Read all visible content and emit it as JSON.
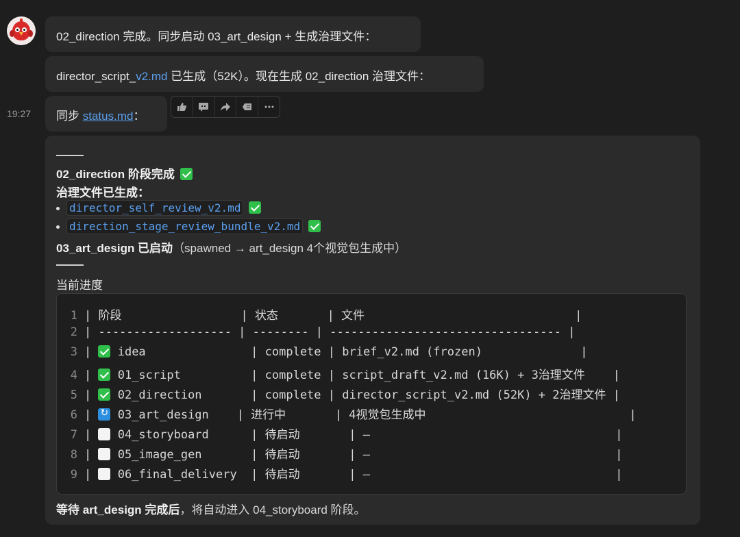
{
  "messages": {
    "m1": "02_direction 完成。同步启动 03_art_design + 生成治理文件：",
    "m2_a": "director_script_",
    "m2_link": "v2.md",
    "m2_b": " 已生成（52K）。现在生成 02_direction 治理文件：",
    "m3_a": "同步 ",
    "m3_link": "status.md",
    "m3_b": "：",
    "time": "19:27"
  },
  "actions": [
    "thumbs-up-icon",
    "comment-icon",
    "share-icon",
    "mark-unread-icon",
    "more-icon"
  ],
  "card": {
    "stage_title": "02_direction 阶段完成",
    "gov_label": "治理文件已生成：",
    "files": [
      "director_self_review_v2.md",
      "direction_stage_review_bundle_v2.md"
    ],
    "art_bold": "03_art_design 已启动",
    "art_rest": "（spawned → art_design 4个视觉包生成中）",
    "progress_label": "当前进度",
    "footer_bold": "等待 art_design 完成后",
    "footer_rest": "，将自动进入 04_storyboard 阶段。"
  },
  "table_rows": [
    {
      "n": "1",
      "text": "| 阶段                 | 状态       | 文件                              |"
    },
    {
      "n": "2",
      "text": "| ------------------- | -------- | --------------------------------- |"
    },
    {
      "n": "3",
      "status": "done",
      "text": " idea               | complete | brief_v2.md (frozen)              |"
    },
    {
      "n": "4",
      "status": "done",
      "text": " 01_script          | complete | script_draft_v2.md (16K) + 3治理文件    |"
    },
    {
      "n": "5",
      "status": "done",
      "text": " 02_direction       | complete | director_script_v2.md (52K) + 2治理文件 |"
    },
    {
      "n": "6",
      "status": "prog",
      "text": " 03_art_design    | 进行中       | 4视觉包生成中                             |"
    },
    {
      "n": "7",
      "status": "todo",
      "text": " 04_storyboard      | 待启动       | —                                   |"
    },
    {
      "n": "8",
      "status": "todo",
      "text": " 05_image_gen       | 待启动       | —                                   |"
    },
    {
      "n": "9",
      "status": "todo",
      "text": " 06_final_delivery  | 待启动       | —                                   |"
    }
  ],
  "colors": {
    "background": "#1e1e1e",
    "bubble": "#2b2b2b",
    "link": "#5aa0f0",
    "check": "#2fbf4a",
    "progress": "#2d8fe0"
  }
}
